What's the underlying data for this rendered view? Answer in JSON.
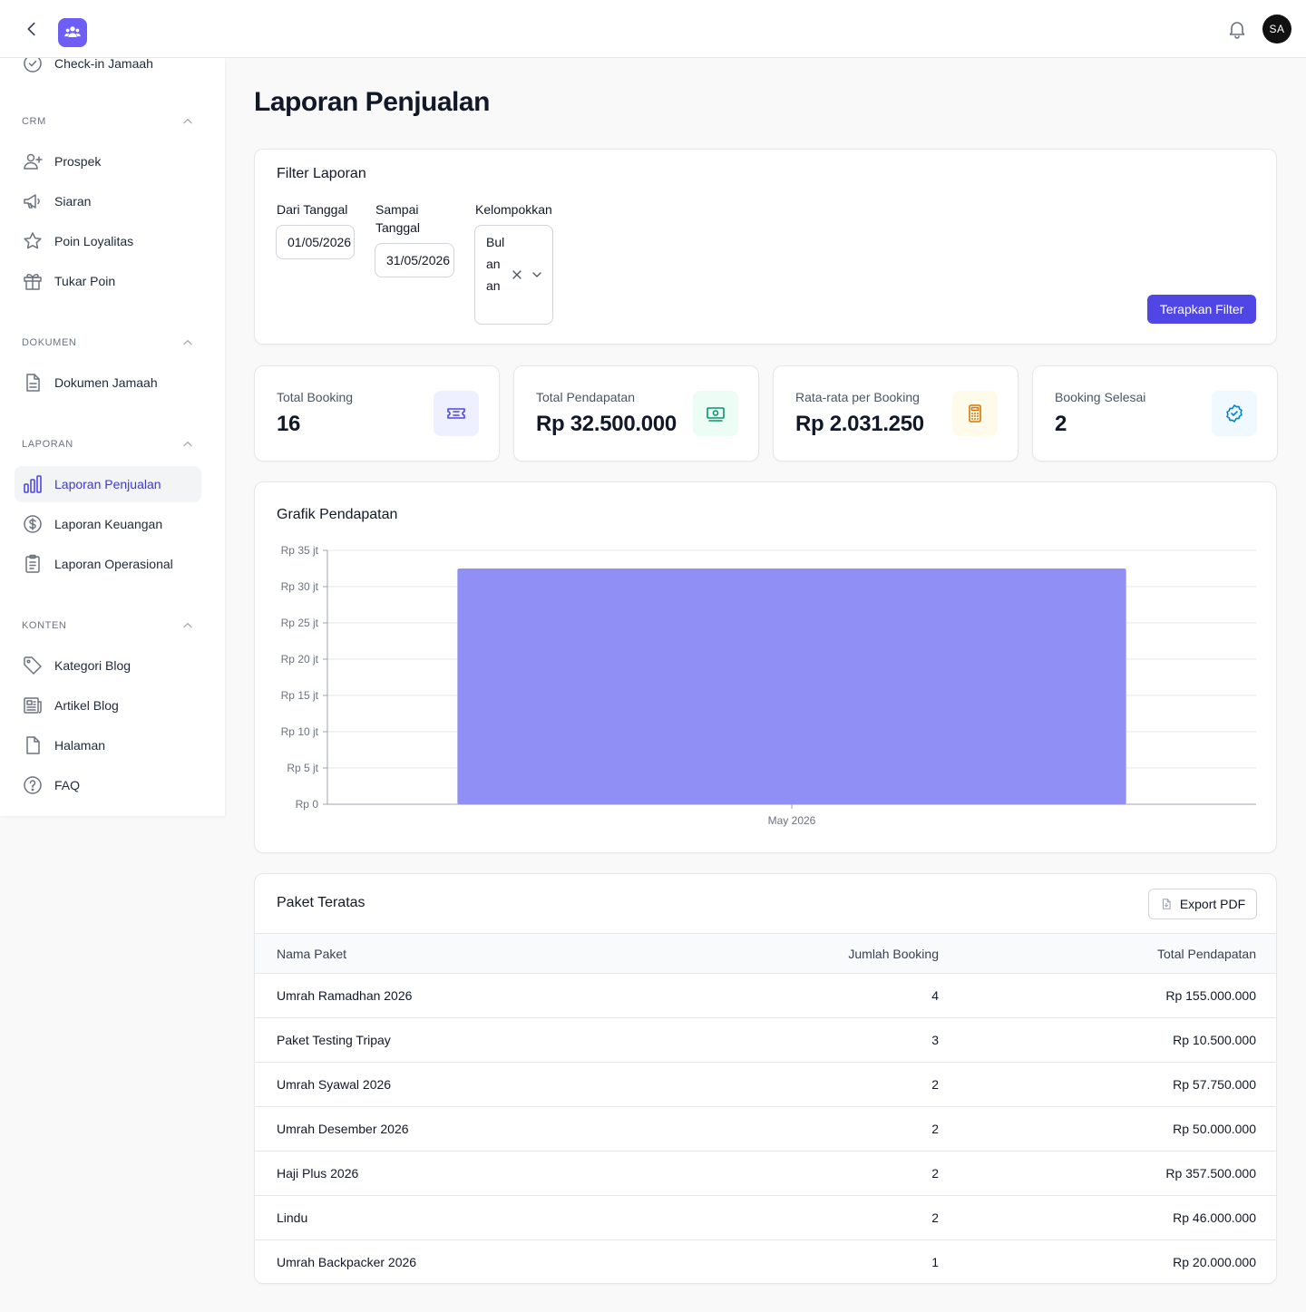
{
  "header": {
    "avatar_initials": "SA",
    "icons": [
      "chevron-left-icon",
      "users-icon",
      "bell-icon"
    ]
  },
  "sidebar": {
    "partial_item": "Check-in Jamaah",
    "sections": [
      {
        "title": "CRM",
        "items": [
          "Prospek",
          "Siaran",
          "Poin Loyalitas",
          "Tukar Poin"
        ]
      },
      {
        "title": "DOKUMEN",
        "items": [
          "Dokumen Jamaah"
        ]
      },
      {
        "title": "LAPORAN",
        "items": [
          "Laporan Penjualan",
          "Laporan Keuangan",
          "Laporan Operasional"
        ]
      },
      {
        "title": "KONTEN",
        "items": [
          "Kategori Blog",
          "Artikel Blog",
          "Halaman",
          "FAQ"
        ]
      }
    ],
    "active_item": "Laporan Penjualan",
    "accent_color": "#4f46e5"
  },
  "page": {
    "title": "Laporan Penjualan"
  },
  "filter": {
    "title": "Filter Laporan",
    "from_label": "Dari Tanggal",
    "from_value": "01/05/2026",
    "to_label": "Sampai Tanggal",
    "to_value": "31/05/2026",
    "group_label": "Kelompokkan",
    "group_value": "Bulanan",
    "apply_label": "Terapkan Filter"
  },
  "stats": [
    {
      "label": "Total Booking",
      "value": "16",
      "icon": "ticket-icon",
      "color": "#4f46e5",
      "bg": "#eef0ff"
    },
    {
      "label": "Total Pendapatan",
      "value": "Rp 32.500.000",
      "icon": "banknote-icon",
      "color": "#059669",
      "bg": "#ecfdf5"
    },
    {
      "label": "Rata-rata per Booking",
      "value": "Rp 2.031.250",
      "icon": "calculator-icon",
      "color": "#d97706",
      "bg": "#fffbeb"
    },
    {
      "label": "Booking Selesai",
      "value": "2",
      "icon": "check-badge-icon",
      "color": "#0284c7",
      "bg": "#f0f9ff"
    }
  ],
  "chart_title": "Grafik Pendapatan",
  "chart_data": {
    "type": "bar",
    "categories": [
      "May 2026"
    ],
    "values": [
      32500000
    ],
    "ylim": [
      0,
      35000000
    ],
    "yticks": [
      {
        "value": 0,
        "label": "Rp 0"
      },
      {
        "value": 5000000,
        "label": "Rp 5 jt"
      },
      {
        "value": 10000000,
        "label": "Rp 10 jt"
      },
      {
        "value": 15000000,
        "label": "Rp 15 jt"
      },
      {
        "value": 20000000,
        "label": "Rp 20 jt"
      },
      {
        "value": 25000000,
        "label": "Rp 25 jt"
      },
      {
        "value": 30000000,
        "label": "Rp 30 jt"
      },
      {
        "value": 35000000,
        "label": "Rp 35 jt"
      }
    ],
    "grid": true,
    "bar_color": "#8f8ff5"
  },
  "top_packages": {
    "title": "Paket Teratas",
    "export_label": "Export PDF",
    "columns": [
      "Nama Paket",
      "Jumlah Booking",
      "Total Pendapatan"
    ],
    "rows": [
      [
        "Umrah Ramadhan 2026",
        "4",
        "Rp 155.000.000"
      ],
      [
        "Paket Testing Tripay",
        "3",
        "Rp 10.500.000"
      ],
      [
        "Umrah Syawal 2026",
        "2",
        "Rp 57.750.000"
      ],
      [
        "Umrah Desember 2026",
        "2",
        "Rp 50.000.000"
      ],
      [
        "Haji Plus 2026",
        "2",
        "Rp 357.500.000"
      ],
      [
        "Lindu",
        "2",
        "Rp 46.000.000"
      ],
      [
        "Umrah Backpacker 2026",
        "1",
        "Rp 20.000.000"
      ]
    ]
  }
}
